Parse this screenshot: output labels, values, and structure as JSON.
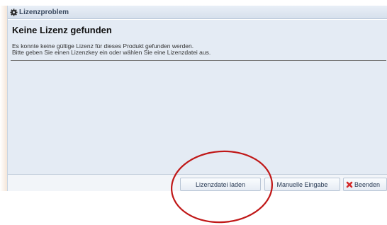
{
  "window": {
    "title": "Lizenzproblem"
  },
  "content": {
    "heading": "Keine Lizenz gefunden",
    "message_line1": "Es konnte keine gültige Lizenz für dieses Produkt gefunden werden.",
    "message_line2": "Bitte geben Sie einen Lizenzkey ein oder wählen Sie eine Lizenzdatei aus."
  },
  "buttons": {
    "load_file": "Lizenzdatei laden",
    "manual_entry": "Manuelle Eingabe",
    "quit": "Beenden"
  },
  "icons": {
    "title_icon": "gear-icon",
    "quit_icon": "red-x-icon"
  },
  "colors": {
    "annotation_circle": "#c01818",
    "quit_x": "#d42a2a"
  }
}
